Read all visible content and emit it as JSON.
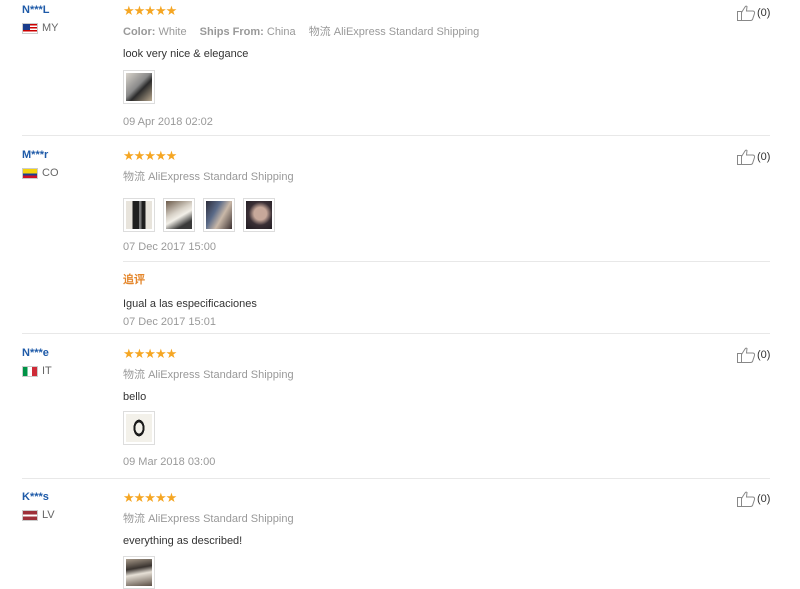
{
  "labels": {
    "color": "Color:",
    "ships_from": "Ships From:",
    "logistics": "物流",
    "followup": "追评"
  },
  "reviews": [
    {
      "user": "N***L",
      "country": "MY",
      "rating": "★★★★★",
      "color_value": "White",
      "ships_from_value": "China",
      "shipping": "AliExpress Standard Shipping",
      "text": "look very nice & elegance",
      "date": "09 Apr 2018 02:02",
      "likes": "(0)"
    },
    {
      "user": "M***r",
      "country": "CO",
      "rating": "★★★★★",
      "shipping": "AliExpress Standard Shipping",
      "date": "07 Dec 2017 15:00",
      "followup_text": "Igual a las especificaciones",
      "followup_date": "07 Dec 2017 15:01",
      "likes": "(0)"
    },
    {
      "user": "N***e",
      "country": "IT",
      "rating": "★★★★★",
      "shipping": "AliExpress Standard Shipping",
      "text": "bello",
      "date": "09 Mar 2018 03:00",
      "likes": "(0)"
    },
    {
      "user": "K***s",
      "country": "LV",
      "rating": "★★★★★",
      "shipping": "AliExpress Standard Shipping",
      "text": "everything as described!",
      "likes": "(0)"
    }
  ],
  "colors": {
    "username": "#1e5aa8",
    "star": "#f5a623",
    "followup": "#e4862b"
  }
}
